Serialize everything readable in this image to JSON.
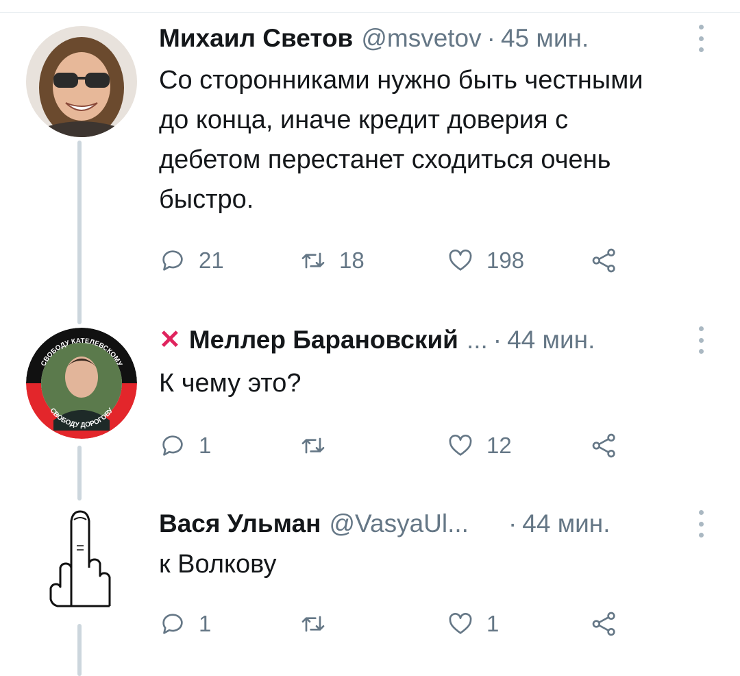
{
  "tweets": [
    {
      "name": "Михаил Светов",
      "handle": "@msvetov",
      "separator": "·",
      "time": "45 мин.",
      "text": "Со сторонниками нужно быть честными до конца, иначе кредит доверия с дебетом перестанет сходиться очень быстро.",
      "replies": "21",
      "retweets": "18",
      "likes": "198"
    },
    {
      "name": "Меллер Барановский",
      "name_prefix": "✕",
      "handle": "...",
      "separator": "·",
      "time": "44 мин.",
      "text": "К чему это?",
      "replies": "1",
      "retweets": "",
      "likes": "12",
      "avatar_badge_top": "СВОБОДУ КАТЕЛЕВСКОМУ",
      "avatar_badge_bottom": "СВОБОДУ ДОРОГОВУ"
    },
    {
      "name": "Вася Ульман",
      "handle": "@VasyaUl...",
      "separator": "·",
      "time": "44 мин.",
      "text": "к Волкову",
      "replies": "1",
      "retweets": "",
      "likes": "1"
    }
  ],
  "icons": {
    "reply": "reply-icon",
    "retweet": "retweet-icon",
    "like": "heart-icon",
    "share": "share-icon",
    "more": "more-vertical-icon"
  },
  "colors": {
    "text": "#14171a",
    "secondary": "#657786",
    "thread_line": "#ccd6dd",
    "cross": "#e0245e"
  }
}
